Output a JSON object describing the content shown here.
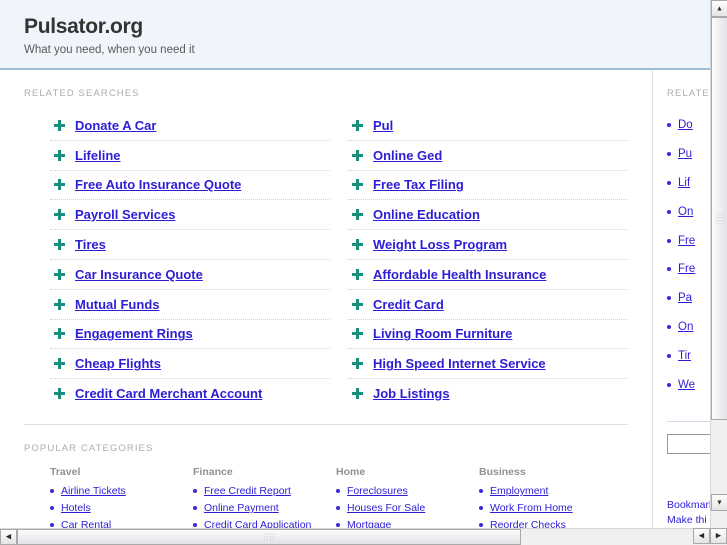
{
  "header": {
    "title": "Pulsator.org",
    "tagline": "What you need, when you need it"
  },
  "main": {
    "related_caption": "RELATED SEARCHES",
    "related_left": [
      "Donate A Car",
      "Lifeline",
      "Free Auto Insurance Quote",
      "Payroll Services",
      "Tires",
      "Car Insurance Quote",
      "Mutual Funds",
      "Engagement Rings",
      "Cheap Flights",
      "Credit Card Merchant Account"
    ],
    "related_right": [
      "Pul",
      "Online Ged",
      "Free Tax Filing",
      "Online Education",
      "Weight Loss Program",
      "Affordable Health Insurance",
      "Credit Card",
      "Living Room Furniture",
      "High Speed Internet Service",
      "Job Listings"
    ],
    "categories_caption": "POPULAR CATEGORIES",
    "categories": [
      {
        "title": "Travel",
        "items": [
          "Airline Tickets",
          "Hotels",
          "Car Rental"
        ]
      },
      {
        "title": "Finance",
        "items": [
          "Free Credit Report",
          "Online Payment",
          "Credit Card Application"
        ]
      },
      {
        "title": "Home",
        "items": [
          "Foreclosures",
          "Houses For Sale",
          "Mortgage"
        ]
      },
      {
        "title": "Business",
        "items": [
          "Employment",
          "Work From Home",
          "Reorder Checks"
        ]
      }
    ]
  },
  "rail": {
    "caption": "RELATED",
    "items": [
      "Do",
      "Pu",
      "Lif",
      "On",
      "Fre",
      "Fre",
      "Pa",
      "On",
      "Tir",
      "We"
    ],
    "input_value": "",
    "bookmark_label": "Bookmark",
    "make_label": "Make thi"
  },
  "scrollbars": {
    "up_arrow": "▲",
    "down_arrow": "▼",
    "left_arrow": "◀",
    "right_arrow": "▶"
  },
  "colors": {
    "link": "#2d1ed6",
    "header_bg": "#eff5fa",
    "header_rule": "#9ebdd8",
    "marker_green": "#178f7e",
    "caption_gray": "#a8adb3"
  }
}
